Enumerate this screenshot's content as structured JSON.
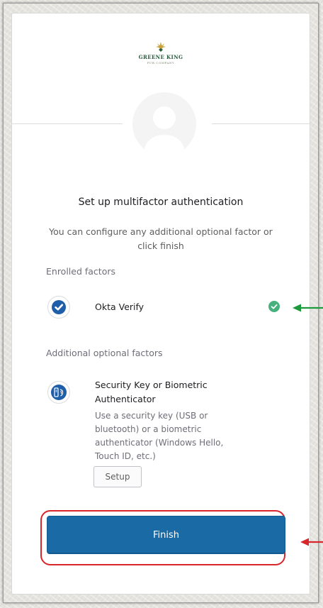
{
  "brand": {
    "name": "GREENE KING",
    "tagline": "PUB COMPANY"
  },
  "page": {
    "title": "Set up multifactor authentication",
    "subtitle": "You can configure any additional optional factor or click finish"
  },
  "enrolled": {
    "label": "Enrolled factors",
    "factors": [
      {
        "name": "Okta Verify",
        "status": "enrolled",
        "icon": "okta-verify-icon"
      }
    ]
  },
  "additional": {
    "label": "Additional optional factors",
    "factors": [
      {
        "name": "Security Key or Biometric Authenticator",
        "description": "Use a security key (USB or bluetooth) or a biometric authenticator (Windows Hello, Touch ID, etc.)",
        "action_label": "Setup",
        "icon": "security-key-icon"
      }
    ]
  },
  "actions": {
    "finish_label": "Finish"
  },
  "colors": {
    "primary": "#1a6aa6",
    "success": "#46b17d",
    "annotation_green": "#1c9a3c",
    "annotation_red": "#d9262c"
  }
}
